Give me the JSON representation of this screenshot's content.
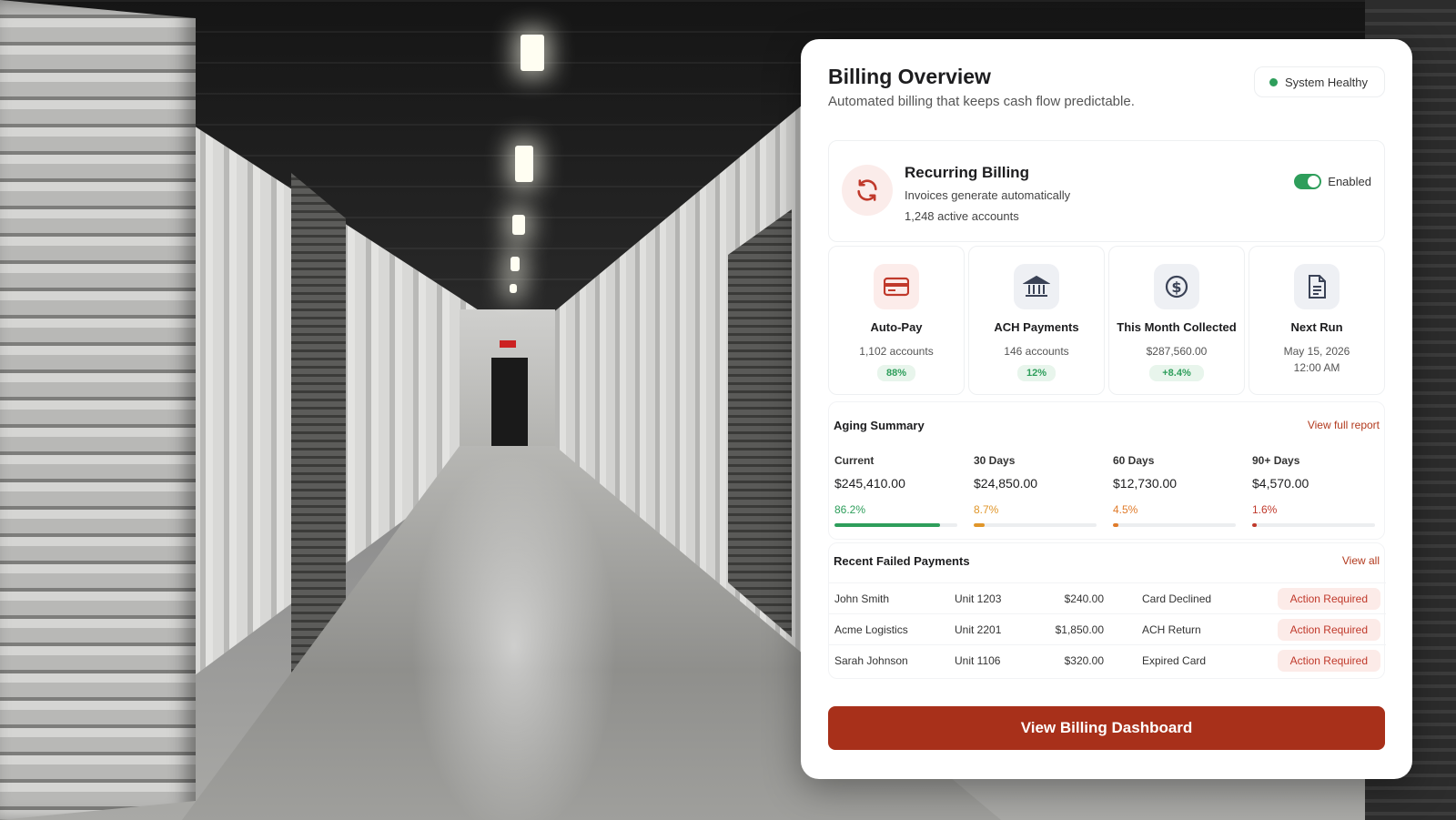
{
  "header": {
    "title": "Billing Overview",
    "subtitle": "Automated billing that keeps cash flow predictable.",
    "status": "System Healthy"
  },
  "recurring": {
    "icon": "refresh-icon",
    "title": "Recurring Billing",
    "line1": "Invoices generate automatically",
    "line2": "1,248 active accounts",
    "toggle_label": "Enabled",
    "enabled": true
  },
  "stats": [
    {
      "icon": "credit-card-icon",
      "label": "Auto-Pay",
      "value": "1,102 accounts",
      "badge": "88%"
    },
    {
      "icon": "bank-icon",
      "label": "ACH Payments",
      "value": "146 accounts",
      "badge": "12%"
    },
    {
      "icon": "dollar-coin-icon",
      "label": "This Month Collected",
      "value": "$287,560.00",
      "badge": "+8.4%"
    },
    {
      "icon": "document-icon",
      "label": "Next Run",
      "value": "May 15, 2026",
      "value2": "12:00 AM"
    }
  ],
  "aging": {
    "title": "Aging Summary",
    "link": "View full report",
    "buckets": [
      {
        "label": "Current",
        "amount": "$245,410.00",
        "pct": "86.2%",
        "fraction": 0.862
      },
      {
        "label": "30 Days",
        "amount": "$24,850.00",
        "pct": "8.7%",
        "fraction": 0.087
      },
      {
        "label": "60 Days",
        "amount": "$12,730.00",
        "pct": "4.5%",
        "fraction": 0.045
      },
      {
        "label": "90+ Days",
        "amount": "$4,570.00",
        "pct": "1.6%",
        "fraction": 0.016
      }
    ]
  },
  "failed": {
    "title": "Recent Failed Payments",
    "link": "View all",
    "rows": [
      {
        "name": "John Smith",
        "unit": "Unit 1203",
        "amount": "$240.00",
        "reason": "Card Declined",
        "badge": "Action Required"
      },
      {
        "name": "Acme Logistics",
        "unit": "Unit 2201",
        "amount": "$1,850.00",
        "reason": "ACH Return",
        "badge": "Action Required"
      },
      {
        "name": "Sarah Johnson",
        "unit": "Unit 1106",
        "amount": "$320.00",
        "reason": "Expired Card",
        "badge": "Action Required"
      }
    ]
  },
  "cta": {
    "label": "View Billing Dashboard"
  },
  "colors": {
    "accent": "#a8301a",
    "success": "#2e9e5b",
    "bucket_colors": [
      "#2e9e5b",
      "#e0962a",
      "#e07b2a",
      "#c0392b"
    ]
  }
}
